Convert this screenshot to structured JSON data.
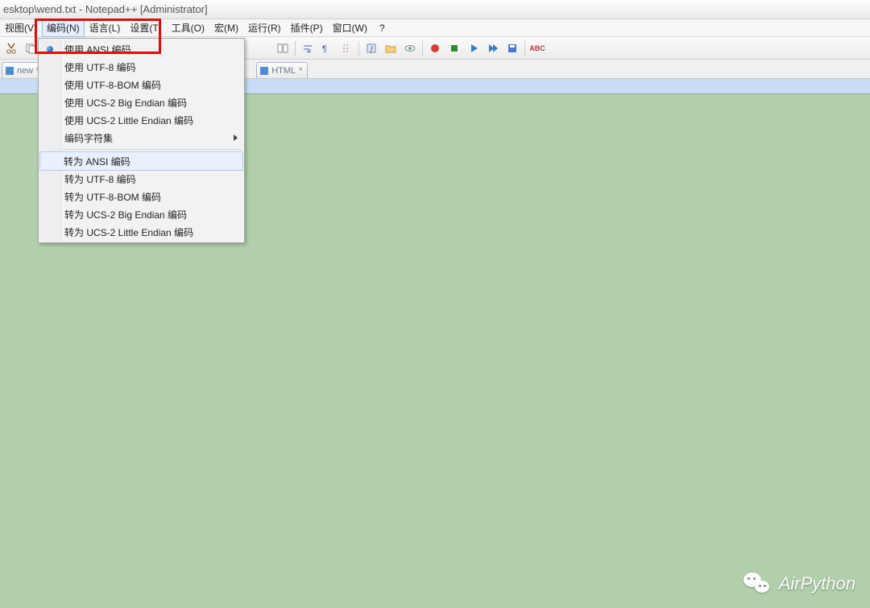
{
  "titlebar": "esktop\\wend.txt - Notepad++ [Administrator]",
  "menubar": {
    "items": [
      {
        "label": "视图(V)"
      },
      {
        "label": "编码(N)",
        "active": true
      },
      {
        "label": "语言(L)"
      },
      {
        "label": "设置(T)"
      },
      {
        "label": "工具(O)"
      },
      {
        "label": "宏(M)"
      },
      {
        "label": "运行(R)"
      },
      {
        "label": "插件(P)"
      },
      {
        "label": "窗口(W)"
      }
    ],
    "help": "?"
  },
  "tabs": [
    {
      "label": "new"
    },
    {
      "label": "HTML"
    }
  ],
  "dropdown": {
    "items": [
      {
        "label": "使用 ANSI 编码",
        "bullet": true,
        "highlighted": true
      },
      {
        "label": "使用 UTF-8 编码"
      },
      {
        "label": "使用 UTF-8-BOM 编码"
      },
      {
        "label": "使用 UCS-2 Big Endian 编码"
      },
      {
        "label": "使用 UCS-2 Little Endian 编码"
      },
      {
        "label": "编码字符集",
        "submenu": true
      },
      {
        "separator": true
      },
      {
        "label": "转为 ANSI 编码",
        "hover": true
      },
      {
        "label": "转为 UTF-8 编码"
      },
      {
        "label": "转为 UTF-8-BOM 编码"
      },
      {
        "label": "转为 UCS-2 Big Endian 编码"
      },
      {
        "label": "转为 UCS-2 Little Endian 编码"
      }
    ]
  },
  "watermark": "AirPython"
}
